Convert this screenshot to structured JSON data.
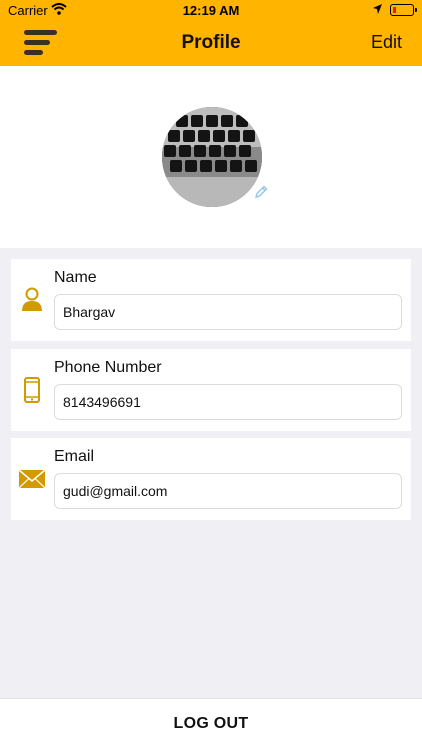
{
  "status": {
    "carrier": "Carrier",
    "time": "12:19 AM"
  },
  "nav": {
    "title": "Profile",
    "edit_label": "Edit"
  },
  "fields": {
    "name": {
      "label": "Name",
      "value": "Bhargav"
    },
    "phone": {
      "label": "Phone Number",
      "value": "8143496691"
    },
    "email": {
      "label": "Email",
      "value": "gudi@gmail.com"
    }
  },
  "footer": {
    "logout_label": "LOG OUT"
  },
  "colors": {
    "accent": "#ffb400",
    "icon": "#d39a00",
    "background": "#efeff4"
  },
  "icons": [
    "menu-icon",
    "pencil-icon",
    "person-icon",
    "phone-icon",
    "envelope-icon",
    "wifi-icon",
    "location-icon",
    "battery-icon"
  ]
}
